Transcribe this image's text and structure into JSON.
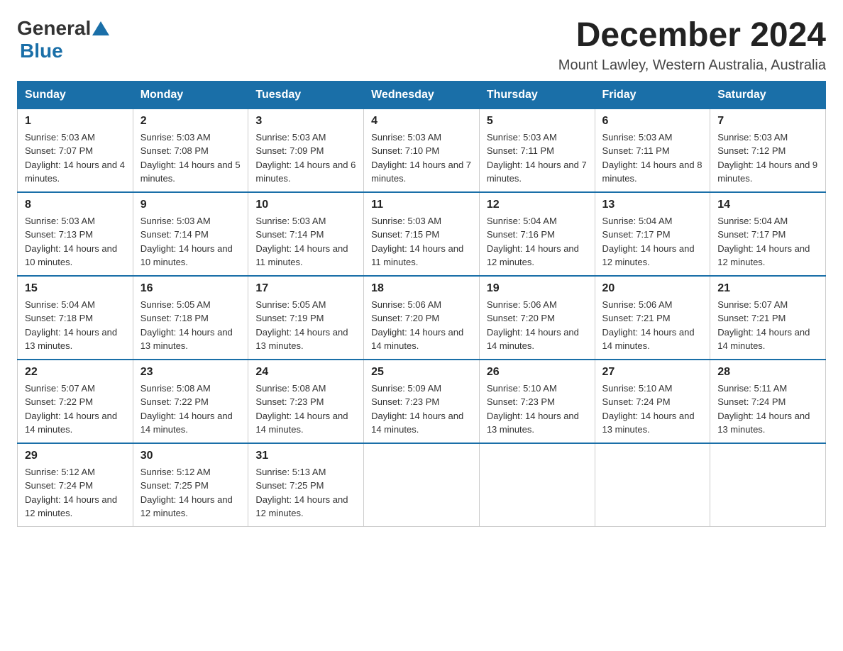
{
  "logo": {
    "general": "General",
    "blue": "Blue"
  },
  "title": "December 2024",
  "location": "Mount Lawley, Western Australia, Australia",
  "days_of_week": [
    "Sunday",
    "Monday",
    "Tuesday",
    "Wednesday",
    "Thursday",
    "Friday",
    "Saturday"
  ],
  "weeks": [
    [
      {
        "day": "1",
        "sunrise": "5:03 AM",
        "sunset": "7:07 PM",
        "daylight": "14 hours and 4 minutes."
      },
      {
        "day": "2",
        "sunrise": "5:03 AM",
        "sunset": "7:08 PM",
        "daylight": "14 hours and 5 minutes."
      },
      {
        "day": "3",
        "sunrise": "5:03 AM",
        "sunset": "7:09 PM",
        "daylight": "14 hours and 6 minutes."
      },
      {
        "day": "4",
        "sunrise": "5:03 AM",
        "sunset": "7:10 PM",
        "daylight": "14 hours and 7 minutes."
      },
      {
        "day": "5",
        "sunrise": "5:03 AM",
        "sunset": "7:11 PM",
        "daylight": "14 hours and 7 minutes."
      },
      {
        "day": "6",
        "sunrise": "5:03 AM",
        "sunset": "7:11 PM",
        "daylight": "14 hours and 8 minutes."
      },
      {
        "day": "7",
        "sunrise": "5:03 AM",
        "sunset": "7:12 PM",
        "daylight": "14 hours and 9 minutes."
      }
    ],
    [
      {
        "day": "8",
        "sunrise": "5:03 AM",
        "sunset": "7:13 PM",
        "daylight": "14 hours and 10 minutes."
      },
      {
        "day": "9",
        "sunrise": "5:03 AM",
        "sunset": "7:14 PM",
        "daylight": "14 hours and 10 minutes."
      },
      {
        "day": "10",
        "sunrise": "5:03 AM",
        "sunset": "7:14 PM",
        "daylight": "14 hours and 11 minutes."
      },
      {
        "day": "11",
        "sunrise": "5:03 AM",
        "sunset": "7:15 PM",
        "daylight": "14 hours and 11 minutes."
      },
      {
        "day": "12",
        "sunrise": "5:04 AM",
        "sunset": "7:16 PM",
        "daylight": "14 hours and 12 minutes."
      },
      {
        "day": "13",
        "sunrise": "5:04 AM",
        "sunset": "7:17 PM",
        "daylight": "14 hours and 12 minutes."
      },
      {
        "day": "14",
        "sunrise": "5:04 AM",
        "sunset": "7:17 PM",
        "daylight": "14 hours and 12 minutes."
      }
    ],
    [
      {
        "day": "15",
        "sunrise": "5:04 AM",
        "sunset": "7:18 PM",
        "daylight": "14 hours and 13 minutes."
      },
      {
        "day": "16",
        "sunrise": "5:05 AM",
        "sunset": "7:18 PM",
        "daylight": "14 hours and 13 minutes."
      },
      {
        "day": "17",
        "sunrise": "5:05 AM",
        "sunset": "7:19 PM",
        "daylight": "14 hours and 13 minutes."
      },
      {
        "day": "18",
        "sunrise": "5:06 AM",
        "sunset": "7:20 PM",
        "daylight": "14 hours and 14 minutes."
      },
      {
        "day": "19",
        "sunrise": "5:06 AM",
        "sunset": "7:20 PM",
        "daylight": "14 hours and 14 minutes."
      },
      {
        "day": "20",
        "sunrise": "5:06 AM",
        "sunset": "7:21 PM",
        "daylight": "14 hours and 14 minutes."
      },
      {
        "day": "21",
        "sunrise": "5:07 AM",
        "sunset": "7:21 PM",
        "daylight": "14 hours and 14 minutes."
      }
    ],
    [
      {
        "day": "22",
        "sunrise": "5:07 AM",
        "sunset": "7:22 PM",
        "daylight": "14 hours and 14 minutes."
      },
      {
        "day": "23",
        "sunrise": "5:08 AM",
        "sunset": "7:22 PM",
        "daylight": "14 hours and 14 minutes."
      },
      {
        "day": "24",
        "sunrise": "5:08 AM",
        "sunset": "7:23 PM",
        "daylight": "14 hours and 14 minutes."
      },
      {
        "day": "25",
        "sunrise": "5:09 AM",
        "sunset": "7:23 PM",
        "daylight": "14 hours and 14 minutes."
      },
      {
        "day": "26",
        "sunrise": "5:10 AM",
        "sunset": "7:23 PM",
        "daylight": "14 hours and 13 minutes."
      },
      {
        "day": "27",
        "sunrise": "5:10 AM",
        "sunset": "7:24 PM",
        "daylight": "14 hours and 13 minutes."
      },
      {
        "day": "28",
        "sunrise": "5:11 AM",
        "sunset": "7:24 PM",
        "daylight": "14 hours and 13 minutes."
      }
    ],
    [
      {
        "day": "29",
        "sunrise": "5:12 AM",
        "sunset": "7:24 PM",
        "daylight": "14 hours and 12 minutes."
      },
      {
        "day": "30",
        "sunrise": "5:12 AM",
        "sunset": "7:25 PM",
        "daylight": "14 hours and 12 minutes."
      },
      {
        "day": "31",
        "sunrise": "5:13 AM",
        "sunset": "7:25 PM",
        "daylight": "14 hours and 12 minutes."
      },
      null,
      null,
      null,
      null
    ]
  ],
  "labels": {
    "sunrise": "Sunrise:",
    "sunset": "Sunset:",
    "daylight": "Daylight:"
  }
}
